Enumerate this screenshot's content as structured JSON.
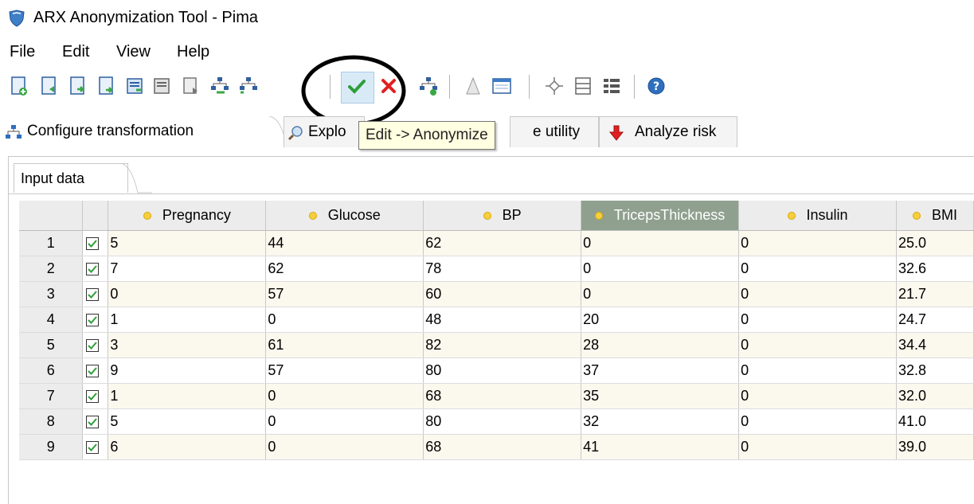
{
  "window": {
    "title": "ARX Anonymization Tool - Pima",
    "icon": "arx-shield-icon"
  },
  "menu": [
    "File",
    "Edit",
    "View",
    "Help"
  ],
  "toolbar": {
    "buttons": [
      "new-project",
      "open-project",
      "save-project",
      "save-project-as",
      "import-data",
      "export-data",
      "close-project",
      "import-hierarchy",
      "export-hierarchy",
      "anonymize",
      "delete",
      "create-hierarchy",
      "find-replace",
      "settings",
      "navigate",
      "list-view",
      "tile-view",
      "help"
    ],
    "active_button": "anonymize",
    "tooltip": "Edit -> Anonymize"
  },
  "tabs": [
    {
      "label": "Configure transformation",
      "icon": "hierarchy-icon",
      "active": true
    },
    {
      "label": "Explo",
      "icon": "magnifier-icon",
      "active": false
    },
    {
      "label": "e utility",
      "icon": "utility-icon",
      "active": false
    },
    {
      "label": "Analyze risk",
      "icon": "red-arrow-icon",
      "active": false
    }
  ],
  "inner_tab": {
    "label": "Input data"
  },
  "table": {
    "columns": [
      "Pregnancy",
      "Glucose",
      "BP",
      "TricepsThickness",
      "Insulin",
      "BMI"
    ],
    "selected_column": "TricepsThickness",
    "rows": [
      {
        "n": "1",
        "checked": true,
        "cells": [
          "5",
          "44",
          "62",
          "0",
          "0",
          "25.0"
        ]
      },
      {
        "n": "2",
        "checked": true,
        "cells": [
          "7",
          "62",
          "78",
          "0",
          "0",
          "32.6"
        ]
      },
      {
        "n": "3",
        "checked": true,
        "cells": [
          "0",
          "57",
          "60",
          "0",
          "0",
          "21.7"
        ]
      },
      {
        "n": "4",
        "checked": true,
        "cells": [
          "1",
          "0",
          "48",
          "20",
          "0",
          "24.7"
        ]
      },
      {
        "n": "5",
        "checked": true,
        "cells": [
          "3",
          "61",
          "82",
          "28",
          "0",
          "34.4"
        ]
      },
      {
        "n": "6",
        "checked": true,
        "cells": [
          "9",
          "57",
          "80",
          "37",
          "0",
          "32.8"
        ]
      },
      {
        "n": "7",
        "checked": true,
        "cells": [
          "1",
          "0",
          "68",
          "35",
          "0",
          "32.0"
        ]
      },
      {
        "n": "8",
        "checked": true,
        "cells": [
          "5",
          "0",
          "80",
          "32",
          "0",
          "41.0"
        ]
      },
      {
        "n": "9",
        "checked": true,
        "cells": [
          "6",
          "0",
          "68",
          "41",
          "0",
          "39.0"
        ]
      }
    ]
  },
  "colors": {
    "accent": "#3a8fd0",
    "row_stripe": "#fbf8ee",
    "header": "#ececec",
    "selected_header": "#8fa08f",
    "check": "#2e9e3a"
  }
}
